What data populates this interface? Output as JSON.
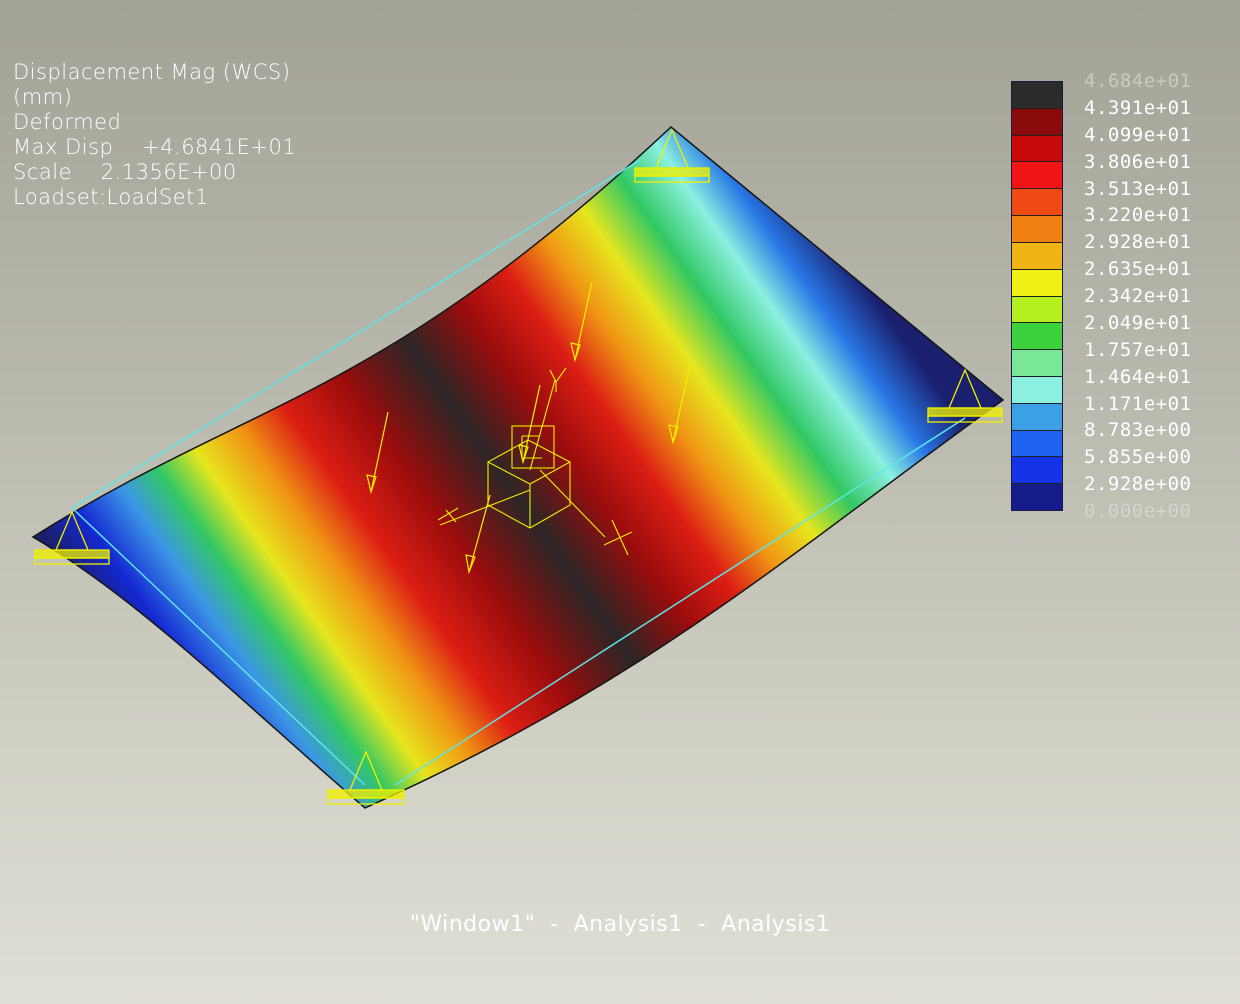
{
  "info": {
    "line1": "Displacement Mag (WCS)",
    "line2": "(mm)",
    "line3": "Deformed",
    "line4": "Max Disp    +4.6841E+01",
    "line5": "Scale    2.1356E+00",
    "line6": "Loadset:LoadSet1"
  },
  "legend": {
    "labels": [
      "4.684e+01",
      "4.391e+01",
      "4.099e+01",
      "3.806e+01",
      "3.513e+01",
      "3.220e+01",
      "2.928e+01",
      "2.635e+01",
      "2.342e+01",
      "2.049e+01",
      "1.757e+01",
      "1.464e+01",
      "1.171e+01",
      "8.783e+00",
      "5.855e+00",
      "2.928e+00",
      "0.000e+00"
    ],
    "colors": [
      "#2b2b2b",
      "#8b0a0a",
      "#c80a0a",
      "#f01414",
      "#f04a14",
      "#f08014",
      "#f0b414",
      "#f0f014",
      "#b4f01e",
      "#3cd23c",
      "#78e896",
      "#8cf0e0",
      "#3ca0e6",
      "#1e64f0",
      "#1432e6",
      "#141c8c"
    ]
  },
  "caption": "\"Window1\"  -  Analysis1  -  Analysis1",
  "colors": {
    "edge": "#5ce6e6",
    "constraint": "#f0f000",
    "text": "#ffffff"
  }
}
